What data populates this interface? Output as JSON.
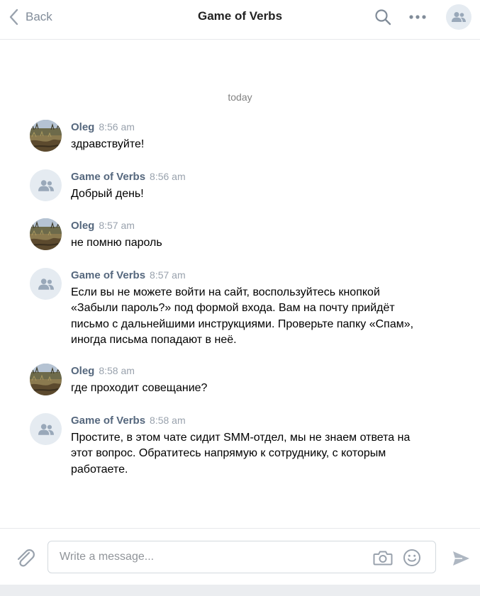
{
  "header": {
    "back_label": "Back",
    "title": "Game of Verbs",
    "icons": [
      "chevron-left-icon",
      "search-icon",
      "more-icon",
      "group-avatar-icon"
    ]
  },
  "date_separator": "today",
  "messages": [
    {
      "author": "Oleg",
      "time": "8:56 am",
      "avatar": "photo",
      "text": "здравствуйте!"
    },
    {
      "author": "Game of Verbs",
      "time": "8:56 am",
      "avatar": "group",
      "text": "Добрый день!"
    },
    {
      "author": "Oleg",
      "time": "8:57 am",
      "avatar": "photo",
      "text": "не помню пароль"
    },
    {
      "author": "Game of Verbs",
      "time": "8:57 am",
      "avatar": "group",
      "text": "Если вы не можете войти на сайт, воспользуйтесь кнопкой «Забыли пароль?» под формой входа. Вам на почту прийдёт письмо с дальнейшими инструкциями. Проверьте папку «Спам», иногда письма попадают в неё."
    },
    {
      "author": "Oleg",
      "time": "8:58 am",
      "avatar": "photo",
      "text": "где проходит совещание?"
    },
    {
      "author": "Game of Verbs",
      "time": "8:58 am",
      "avatar": "group",
      "text": "Простите, в этом чате сидит SMM-отдел, мы не знаем ответа на этот вопрос. Обратитесь напрямую к сотруднику, с которым работаете."
    }
  ],
  "composer": {
    "placeholder": "Write a message...",
    "value": "",
    "icons": [
      "paperclip-icon",
      "camera-icon",
      "emoji-icon",
      "send-icon"
    ]
  },
  "colors": {
    "accent": "#55677d",
    "icon_gray": "#99a2ad",
    "group_avatar_bg": "#e5ebf1"
  }
}
